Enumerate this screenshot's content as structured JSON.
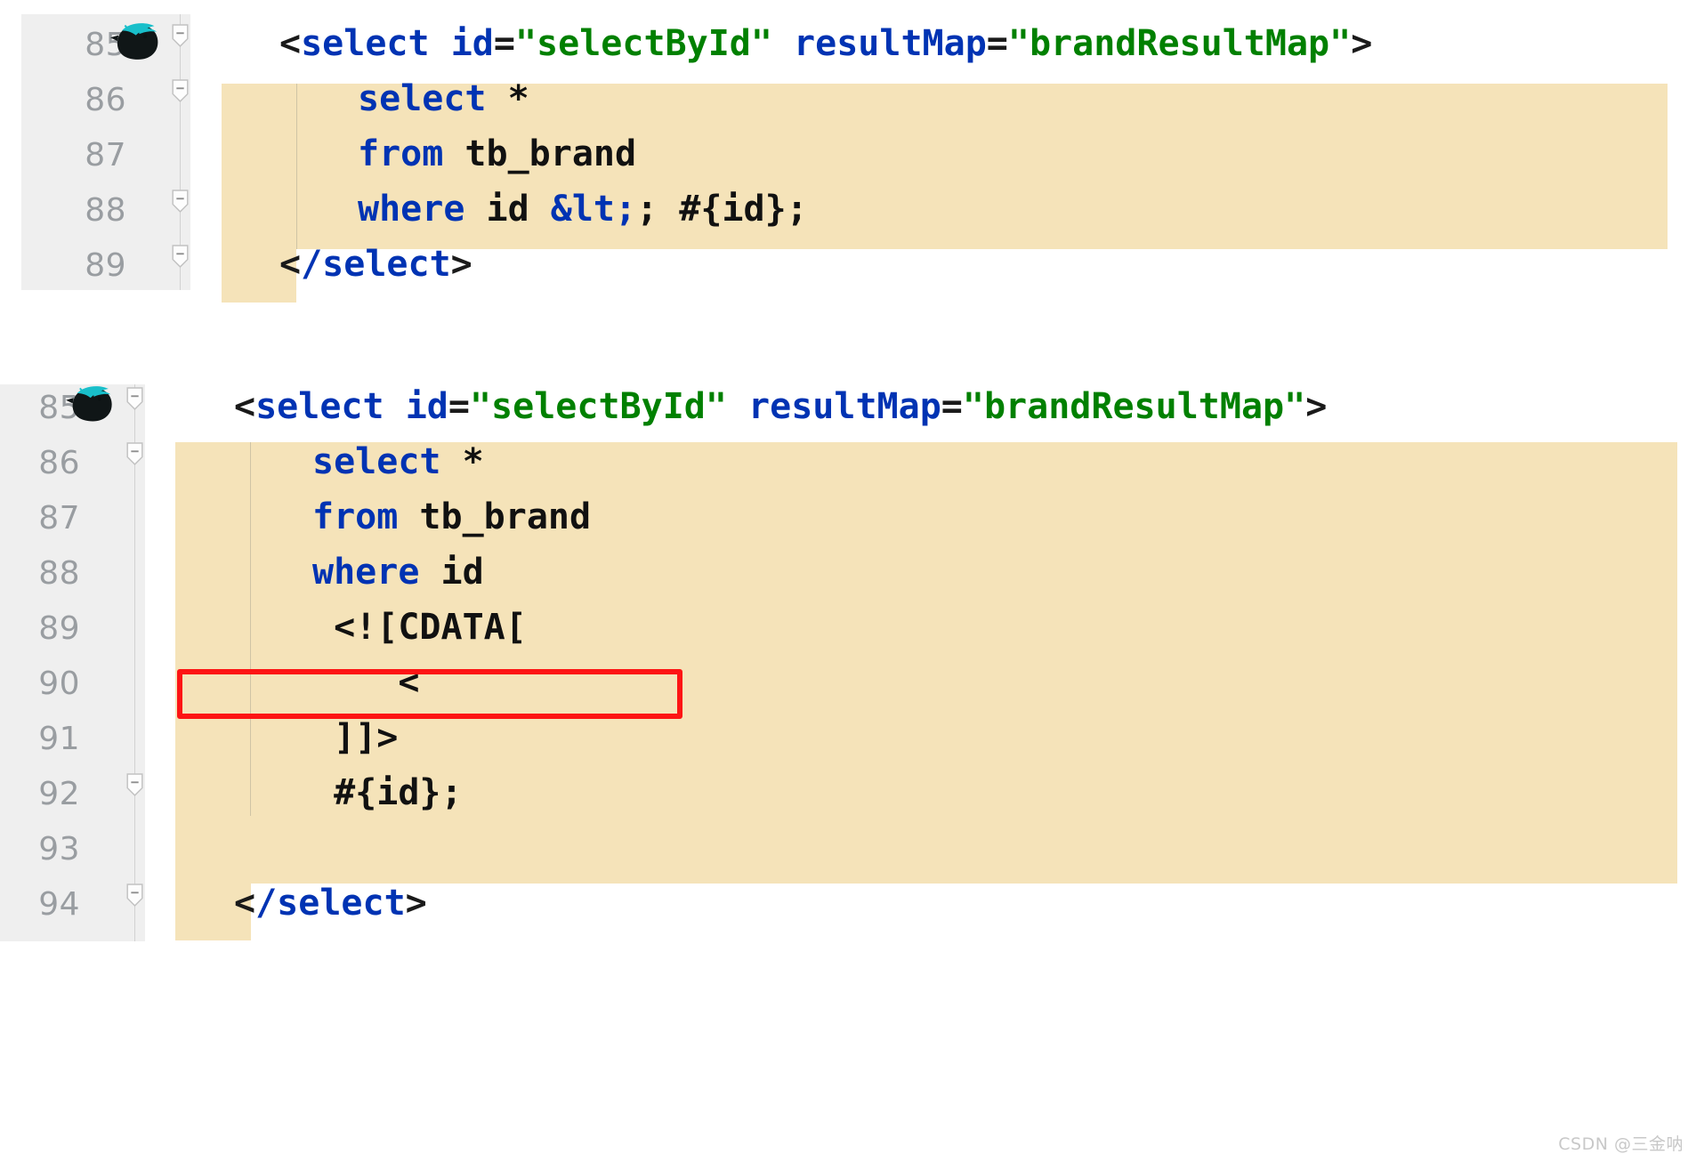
{
  "meta": {
    "watermark": "CSDN @三金呐",
    "colors": {
      "highlight_band": "#f5e3b9",
      "gutter_background": "#efefef",
      "editor_background": "#ffffff",
      "line_number": "#999da1",
      "tag_blue": "#0033b3",
      "string_green": "#008000",
      "punctuation": "#1a1a1a",
      "annotation_red": "#fd1414"
    },
    "icons": {
      "mybatis_bird": "mybatis-bird-icon",
      "fold_minus": "fold-collapse-icon"
    }
  },
  "blocks": [
    {
      "id": "block-top",
      "name": "code-block-entity-escape",
      "lines": [
        {
          "number": "85",
          "indent": 0,
          "has_bird_icon": true,
          "has_fold": true,
          "highlighted": false,
          "tokens": [
            {
              "t": "<",
              "c": "punct"
            },
            {
              "t": "select",
              "c": "tag"
            },
            {
              "t": " ",
              "c": "plain"
            },
            {
              "t": "id",
              "c": "attr"
            },
            {
              "t": "=",
              "c": "eq"
            },
            {
              "t": "\"selectById\"",
              "c": "string"
            },
            {
              "t": " ",
              "c": "plain"
            },
            {
              "t": "resultMap",
              "c": "attr"
            },
            {
              "t": "=",
              "c": "eq"
            },
            {
              "t": "\"brandResultMap\"",
              "c": "string"
            },
            {
              "t": ">",
              "c": "punct"
            }
          ]
        },
        {
          "number": "86",
          "indent": 1,
          "has_bird_icon": false,
          "has_fold": true,
          "highlighted": true,
          "tokens": [
            {
              "t": "select",
              "c": "kw"
            },
            {
              "t": " *",
              "c": "plain"
            }
          ]
        },
        {
          "number": "87",
          "indent": 1,
          "has_bird_icon": false,
          "has_fold": false,
          "highlighted": true,
          "tokens": [
            {
              "t": "from",
              "c": "kw"
            },
            {
              "t": " tb_brand",
              "c": "plain"
            }
          ]
        },
        {
          "number": "88",
          "indent": 1,
          "has_bird_icon": false,
          "has_fold": true,
          "highlighted": true,
          "tokens": [
            {
              "t": "where",
              "c": "kw"
            },
            {
              "t": " id ",
              "c": "plain"
            },
            {
              "t": "&lt;",
              "c": "entity"
            },
            {
              "t": "; #{id};",
              "c": "plain"
            }
          ]
        },
        {
          "number": "89",
          "indent": 0,
          "has_bird_icon": false,
          "has_fold": true,
          "highlighted": false,
          "tokens": [
            {
              "t": "<",
              "c": "punct"
            },
            {
              "t": "/select",
              "c": "tag"
            },
            {
              "t": ">",
              "c": "punct"
            }
          ]
        }
      ]
    },
    {
      "id": "block-bottom",
      "name": "code-block-cdata",
      "lines": [
        {
          "number": "85",
          "indent": 0,
          "has_bird_icon": true,
          "has_fold": true,
          "highlighted": false,
          "tokens": [
            {
              "t": "<",
              "c": "punct"
            },
            {
              "t": "select",
              "c": "tag"
            },
            {
              "t": " ",
              "c": "plain"
            },
            {
              "t": "id",
              "c": "attr"
            },
            {
              "t": "=",
              "c": "eq"
            },
            {
              "t": "\"selectById\"",
              "c": "string"
            },
            {
              "t": " ",
              "c": "plain"
            },
            {
              "t": "resultMap",
              "c": "attr"
            },
            {
              "t": "=",
              "c": "eq"
            },
            {
              "t": "\"brandResultMap\"",
              "c": "string"
            },
            {
              "t": ">",
              "c": "punct"
            }
          ]
        },
        {
          "number": "86",
          "indent": 1,
          "has_bird_icon": false,
          "has_fold": true,
          "highlighted": true,
          "tokens": [
            {
              "t": "select",
              "c": "kw"
            },
            {
              "t": " *",
              "c": "plain"
            }
          ]
        },
        {
          "number": "87",
          "indent": 1,
          "has_bird_icon": false,
          "has_fold": false,
          "highlighted": true,
          "tokens": [
            {
              "t": "from",
              "c": "kw"
            },
            {
              "t": " tb_brand",
              "c": "plain"
            }
          ]
        },
        {
          "number": "88",
          "indent": 1,
          "has_bird_icon": false,
          "has_fold": false,
          "highlighted": true,
          "tokens": [
            {
              "t": "where",
              "c": "kw"
            },
            {
              "t": " id",
              "c": "plain"
            }
          ]
        },
        {
          "number": "89",
          "indent": 1,
          "has_bird_icon": false,
          "has_fold": false,
          "highlighted": true,
          "tokens": [
            {
              "t": " <![CDATA[",
              "c": "plain"
            }
          ]
        },
        {
          "number": "90",
          "indent": 1,
          "has_bird_icon": false,
          "has_fold": false,
          "highlighted": true,
          "boxed": true,
          "tokens": [
            {
              "t": "    <",
              "c": "plain"
            }
          ]
        },
        {
          "number": "91",
          "indent": 1,
          "has_bird_icon": false,
          "has_fold": false,
          "highlighted": true,
          "tokens": [
            {
              "t": " ]]>",
              "c": "plain"
            }
          ]
        },
        {
          "number": "92",
          "indent": 1,
          "has_bird_icon": false,
          "has_fold": true,
          "highlighted": true,
          "tokens": [
            {
              "t": " #{id};",
              "c": "plain"
            }
          ]
        },
        {
          "number": "93",
          "indent": 1,
          "has_bird_icon": false,
          "has_fold": false,
          "highlighted": true,
          "tokens": []
        },
        {
          "number": "94",
          "indent": 0,
          "has_bird_icon": false,
          "has_fold": true,
          "highlighted": false,
          "tokens": [
            {
              "t": "<",
              "c": "punct"
            },
            {
              "t": "/select",
              "c": "tag"
            },
            {
              "t": ">",
              "c": "punct"
            }
          ]
        }
      ]
    }
  ]
}
